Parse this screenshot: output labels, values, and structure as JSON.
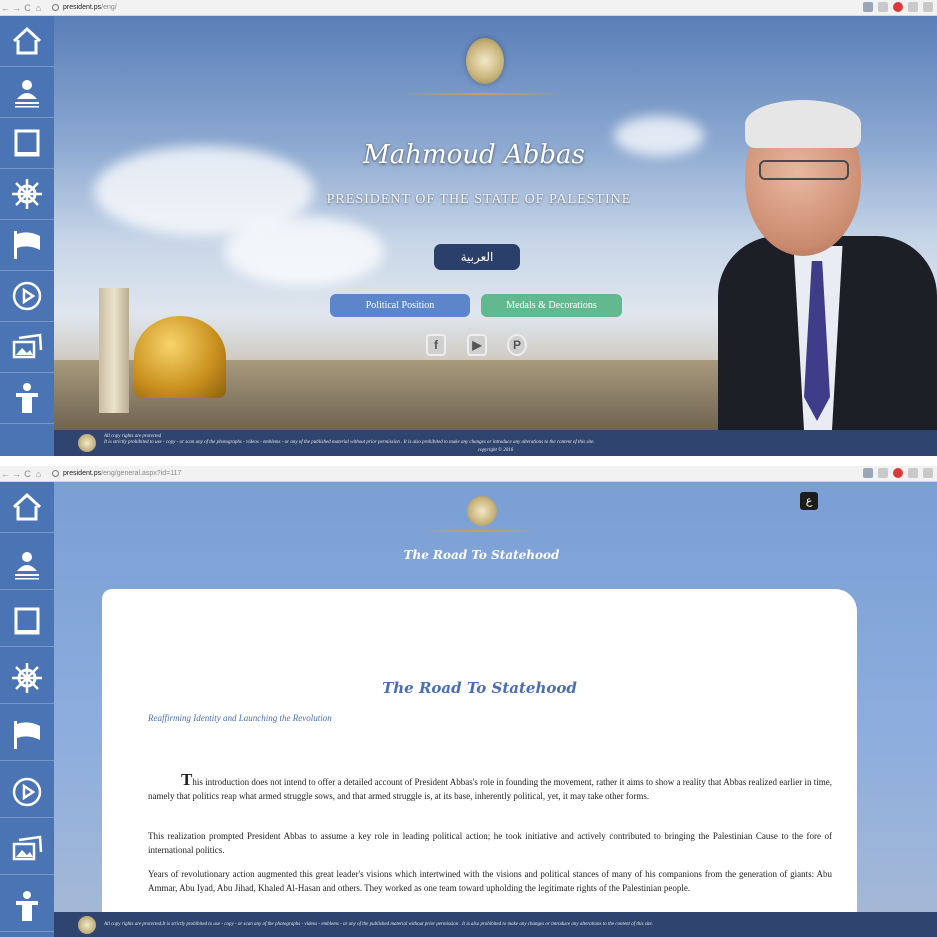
{
  "shot1": {
    "browser": {
      "url_host": "president.ps",
      "url_path": "/eng/"
    },
    "hero": {
      "name": "Mahmoud Abbas",
      "title": "PRESIDENT OF THE STATE OF PALESTINE",
      "arabic_button": "العربية",
      "political_position_button": "Political Position",
      "medals_button": "Medals & Decorations",
      "social": {
        "facebook": "f",
        "youtube": "▶",
        "pinterest": "P"
      }
    },
    "footer": {
      "line1": "All copy rights are protected",
      "line2": "It is strictly prohibited to use - copy - or scan any of the photographs - videos - emblems - or any of the published material without prior permission . It is also prohibited to make any changes or introduce any alterations to the content of this site.",
      "copyright": "copyright © 2016"
    }
  },
  "shot2": {
    "browser": {
      "url_host": "president.ps",
      "url_path": "/eng/general.aspx?id=117"
    },
    "page_heading": "The Road To Statehood",
    "arabic_toggle": "ع",
    "article": {
      "title": "The Road To Statehood",
      "subtitle": "Reaffirming Identity and Launching the Revolution",
      "dropcap": "T",
      "p1": "his introduction does  not intend  to offer a detailed account of President Abbas's  role in founding the movement, rather it aims to  show a reality that Abbas realized earlier in time, namely  that politics reap what armed struggle sows, and that armed struggle is, at its base,  inherently political, yet, it may take  other forms.",
      "p2": "This realization prompted President Abbas to assume a key role in leading political action; he took initiative and actively contributed to bringing the Palestinian Cause to the fore of international politics.",
      "p3": "Years of revolutionary action augmented this great leader's visions which intertwined with the visions and political stances of many of his companions from the generation of giants: Abu Ammar, Abu Iyad, Abu Jihad, Khaled Al-Hasan and others. They worked as one team toward upholding the legitimate rights of the Palestinian people."
    },
    "footer": {
      "text": "All copy rights are protected.It is strictly prohibited to use - copy - or scan any of the photographs - videos - emblems - or any of the published material without prior permission . It is also prohibited to make any changes or introduce any alterations to the content of this site."
    }
  },
  "icons": [
    "home-icon",
    "profile-icon",
    "book-icon",
    "helm-icon",
    "flag-icon",
    "play-icon",
    "photos-icon",
    "speaker-icon"
  ],
  "colors": {
    "sidebar": "#4a74b3",
    "footer": "#2f456f",
    "arabic_button": "#2b3f6b",
    "blue_button": "#5c86c9",
    "green_button": "#63b98f",
    "article_accent": "#4a6fb0"
  }
}
